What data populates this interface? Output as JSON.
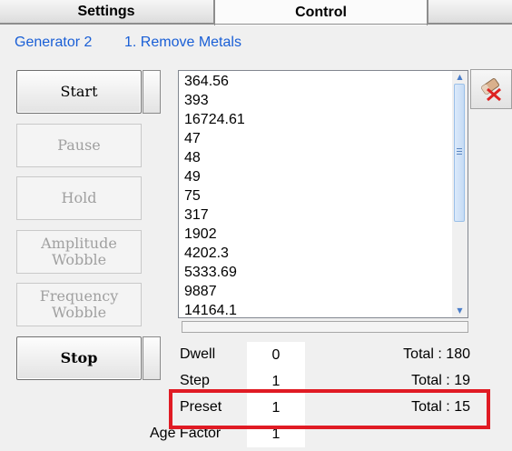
{
  "tabs": [
    {
      "label": "Settings",
      "active": false
    },
    {
      "label": "Control",
      "active": true
    }
  ],
  "breadcrumb": {
    "generator": "Generator 2",
    "step": "1. Remove Metals"
  },
  "buttons": {
    "start": "Start",
    "pause": "Pause",
    "hold": "Hold",
    "amplitude_wobble": "Amplitude Wobble",
    "frequency_wobble": "Frequency Wobble",
    "stop": "Stop"
  },
  "list": {
    "items": [
      "364.56",
      "393",
      "16724.61",
      "47",
      "48",
      "49",
      "75",
      "317",
      "1902",
      "4202.3",
      "5333.69",
      "9887",
      "14164.1"
    ]
  },
  "params": {
    "dwell": {
      "label": "Dwell",
      "value": "0",
      "total": "Total : 180"
    },
    "step": {
      "label": "Step",
      "value": "1",
      "total": "Total : 19"
    },
    "preset": {
      "label": "Preset",
      "value": "1",
      "total": "Total : 15"
    },
    "age_factor": {
      "label": "Age Factor",
      "value": "1"
    }
  },
  "colors": {
    "accent_text": "#1a5fd6",
    "highlight": "#e01b24"
  }
}
